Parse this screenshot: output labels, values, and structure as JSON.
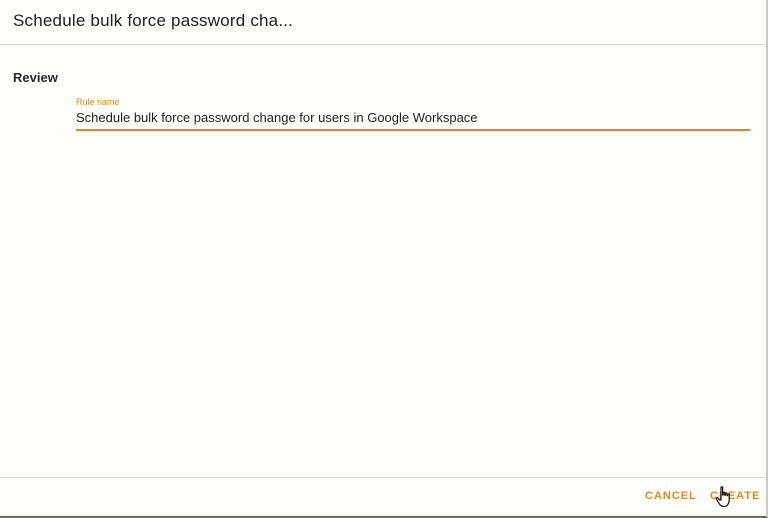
{
  "dialog": {
    "title": "Schedule bulk force password cha..."
  },
  "review": {
    "section_label": "Review",
    "rule_name_label": "Rule name",
    "rule_name_value": "Schedule bulk force password change for users in Google Workspace"
  },
  "footer": {
    "cancel_label": "CANCEL",
    "create_label": "CREATE"
  },
  "colors": {
    "accent": "#e0861e",
    "background": "#fdfdf9",
    "text": "#212121"
  },
  "icons": {
    "cursor": "hand-pointer-icon"
  }
}
